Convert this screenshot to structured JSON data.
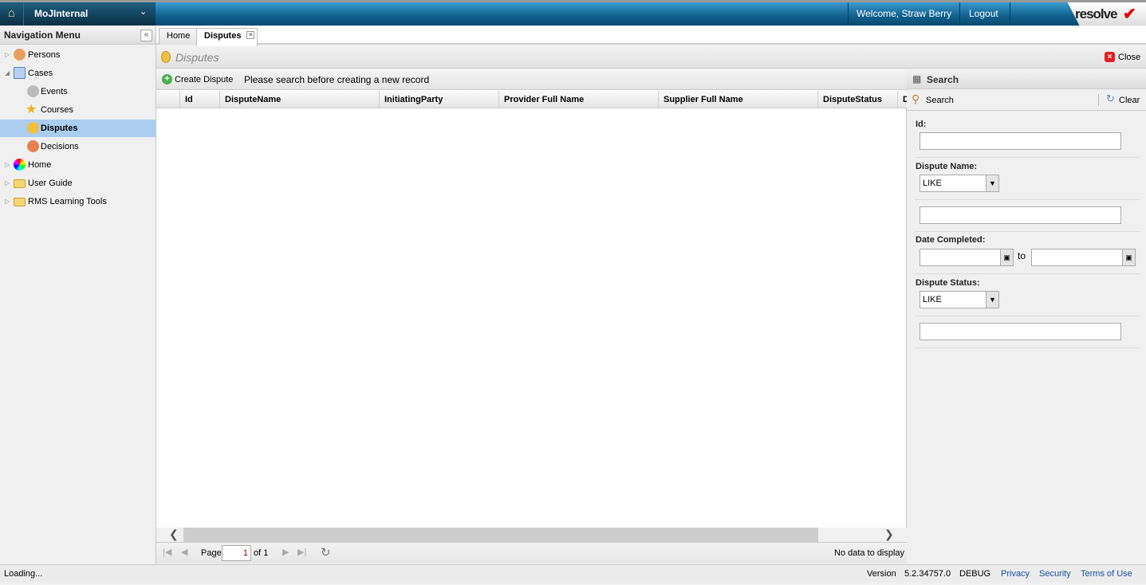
{
  "app": {
    "name": "MoJInternal",
    "welcome": "Welcome, Straw Berry",
    "logout": "Logout",
    "logo": "resolve"
  },
  "sidebar": {
    "title": "Navigation Menu",
    "items": [
      {
        "label": "Persons"
      },
      {
        "label": "Cases"
      },
      {
        "label": "Events"
      },
      {
        "label": "Courses"
      },
      {
        "label": "Disputes"
      },
      {
        "label": "Decisions"
      },
      {
        "label": "Home"
      },
      {
        "label": "User Guide"
      },
      {
        "label": "RMS Learning Tools"
      }
    ]
  },
  "tabs": [
    {
      "label": "Home"
    },
    {
      "label": "Disputes"
    }
  ],
  "panel": {
    "title": "Disputes",
    "close": "Close"
  },
  "grid": {
    "create": "Create Dispute",
    "hint": "Please search before creating a new record",
    "columns": [
      "Id",
      "DisputeName",
      "InitiatingParty",
      "Provider Full Name",
      "Supplier Full Name",
      "DisputeStatus",
      "D"
    ],
    "paging": {
      "page_label": "Page",
      "page": "1",
      "of": "of 1",
      "empty": "No data to display"
    }
  },
  "search": {
    "title": "Search",
    "search_btn": "Search",
    "clear_btn": "Clear",
    "id_label": "Id:",
    "name_label": "Dispute Name:",
    "name_op": "LIKE",
    "date_label": "Date Completed:",
    "to": "to",
    "status_label": "Dispute Status:",
    "status_op": "LIKE"
  },
  "statusbar": {
    "loading": "Loading...",
    "version_label": "Version",
    "version": "5.2.34757.0",
    "mode": "DEBUG",
    "privacy": "Privacy",
    "security": "Security",
    "terms": "Terms of Use"
  }
}
